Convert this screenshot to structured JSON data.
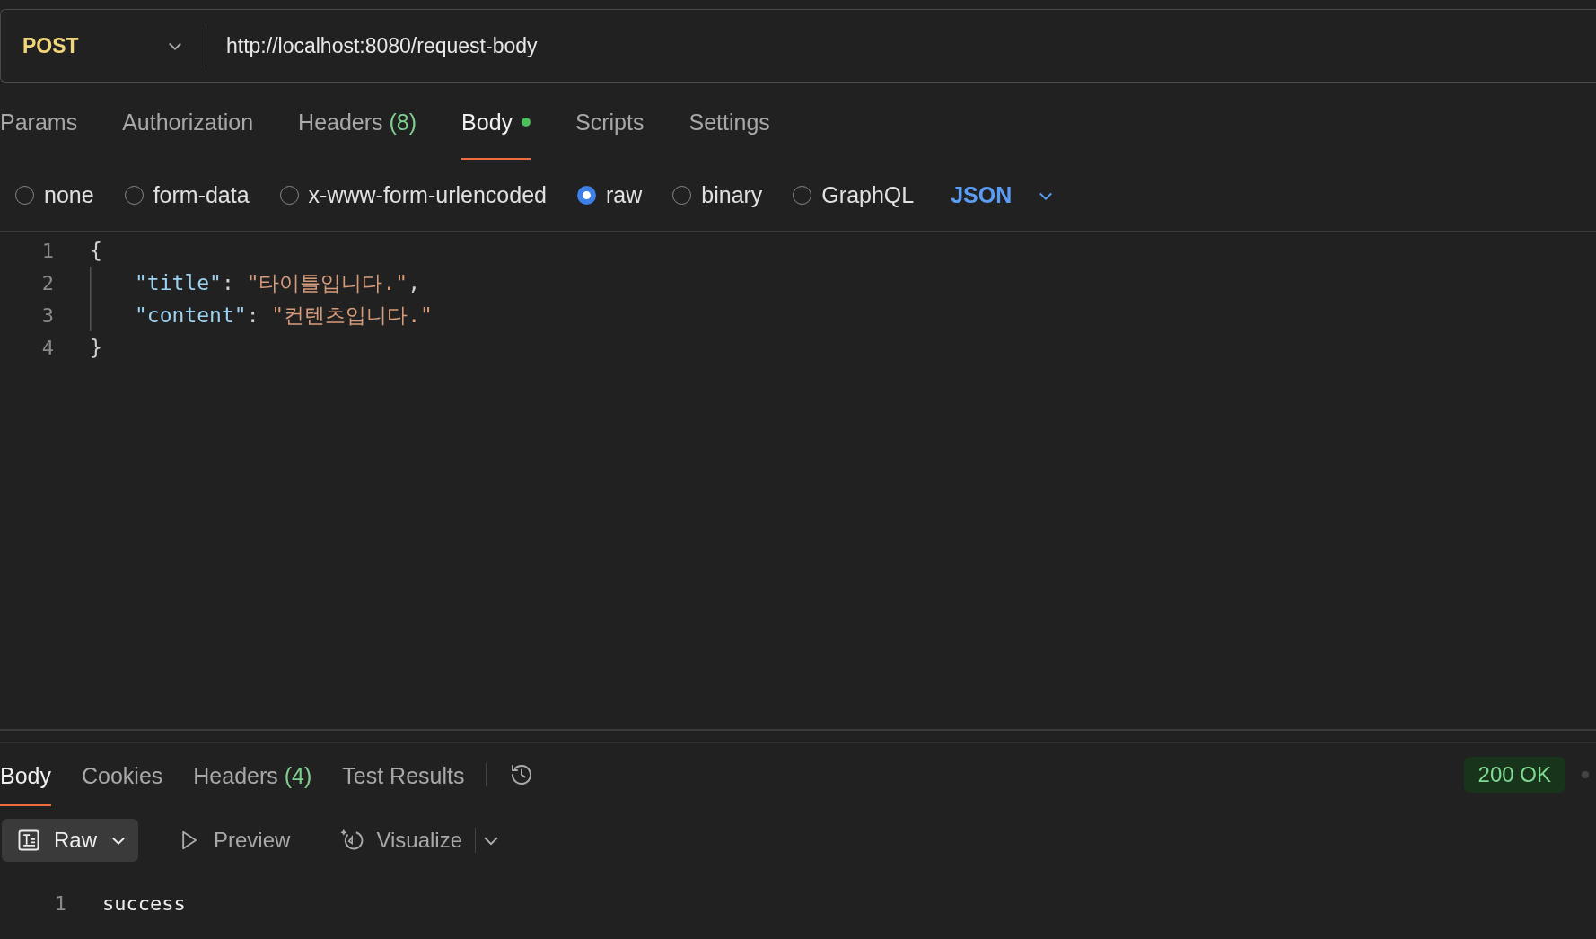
{
  "request": {
    "method": "POST",
    "url": "http://localhost:8080/request-body"
  },
  "request_tabs": [
    {
      "label": "Params",
      "selected": false
    },
    {
      "label": "Authorization",
      "selected": false
    },
    {
      "label": "Headers",
      "count": "(8)",
      "selected": false
    },
    {
      "label": "Body",
      "modified": true,
      "selected": true
    },
    {
      "label": "Scripts",
      "selected": false
    },
    {
      "label": "Settings",
      "selected": false
    }
  ],
  "body_types": [
    {
      "label": "none",
      "selected": false
    },
    {
      "label": "form-data",
      "selected": false
    },
    {
      "label": "x-www-form-urlencoded",
      "selected": false
    },
    {
      "label": "raw",
      "selected": true
    },
    {
      "label": "binary",
      "selected": false
    },
    {
      "label": "GraphQL",
      "selected": false
    }
  ],
  "format": "JSON",
  "editor": {
    "lines": [
      {
        "number": "1",
        "tokens": [
          {
            "kind": "punct",
            "text": "{"
          }
        ],
        "children": [
          {
            "number": "2",
            "tokens": [
              {
                "kind": "key",
                "text": "\"title\""
              },
              {
                "kind": "punct",
                "text": ": "
              },
              {
                "kind": "string",
                "text": "\"타이틀입니다.\""
              },
              {
                "kind": "punct",
                "text": ","
              }
            ]
          },
          {
            "number": "3",
            "tokens": [
              {
                "kind": "key",
                "text": "\"content\""
              },
              {
                "kind": "punct",
                "text": ": "
              },
              {
                "kind": "string",
                "text": "\"컨텐츠입니다.\""
              }
            ]
          }
        ]
      },
      {
        "number": "4",
        "tokens": [
          {
            "kind": "punct",
            "text": "}"
          }
        ]
      }
    ]
  },
  "response_tabs": [
    {
      "label": "Body",
      "selected": true
    },
    {
      "label": "Cookies",
      "selected": false
    },
    {
      "label": "Headers",
      "count": "(4)",
      "selected": false
    },
    {
      "label": "Test Results",
      "selected": false
    }
  ],
  "status": "200 OK",
  "view_modes": [
    {
      "label": "Raw",
      "kind": "raw",
      "selected": true
    },
    {
      "label": "Preview",
      "kind": "preview",
      "selected": false
    },
    {
      "label": "Visualize",
      "kind": "visualize",
      "selected": false
    }
  ],
  "response_lines": [
    {
      "number": "1",
      "text": "success"
    }
  ]
}
